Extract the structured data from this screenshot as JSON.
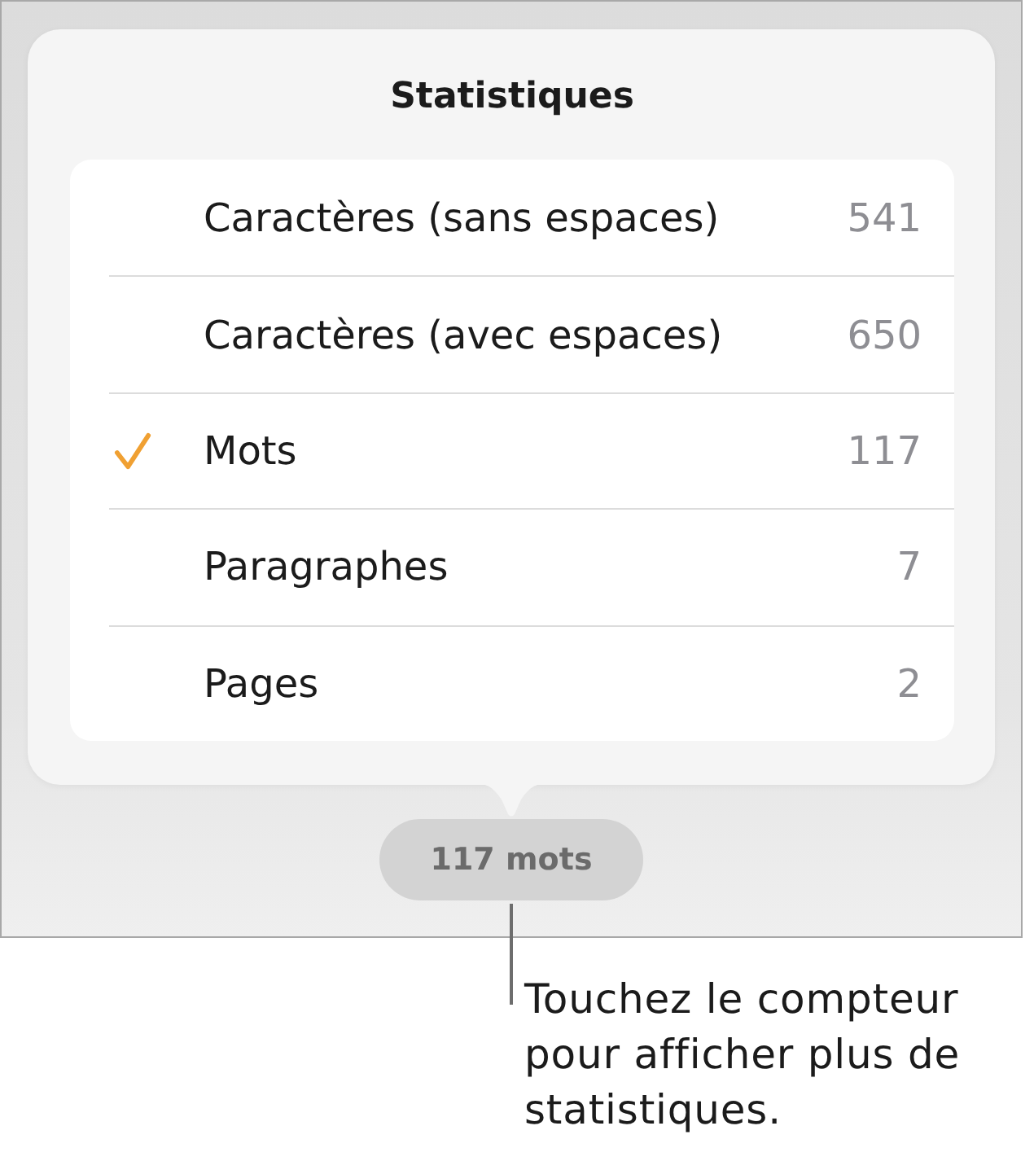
{
  "popover": {
    "title": "Statistiques",
    "rows": [
      {
        "label": "Caractères (sans espaces)",
        "value": "541",
        "selected": false
      },
      {
        "label": "Caractères (avec espaces)",
        "value": "650",
        "selected": false
      },
      {
        "label": "Mots",
        "value": "117",
        "selected": true
      },
      {
        "label": "Paragraphes",
        "value": "7",
        "selected": false
      },
      {
        "label": "Pages",
        "value": "2",
        "selected": false
      }
    ]
  },
  "counter": {
    "label": "117 mots"
  },
  "callout": {
    "text": "Touchez le compteur pour afficher plus de statistiques."
  }
}
